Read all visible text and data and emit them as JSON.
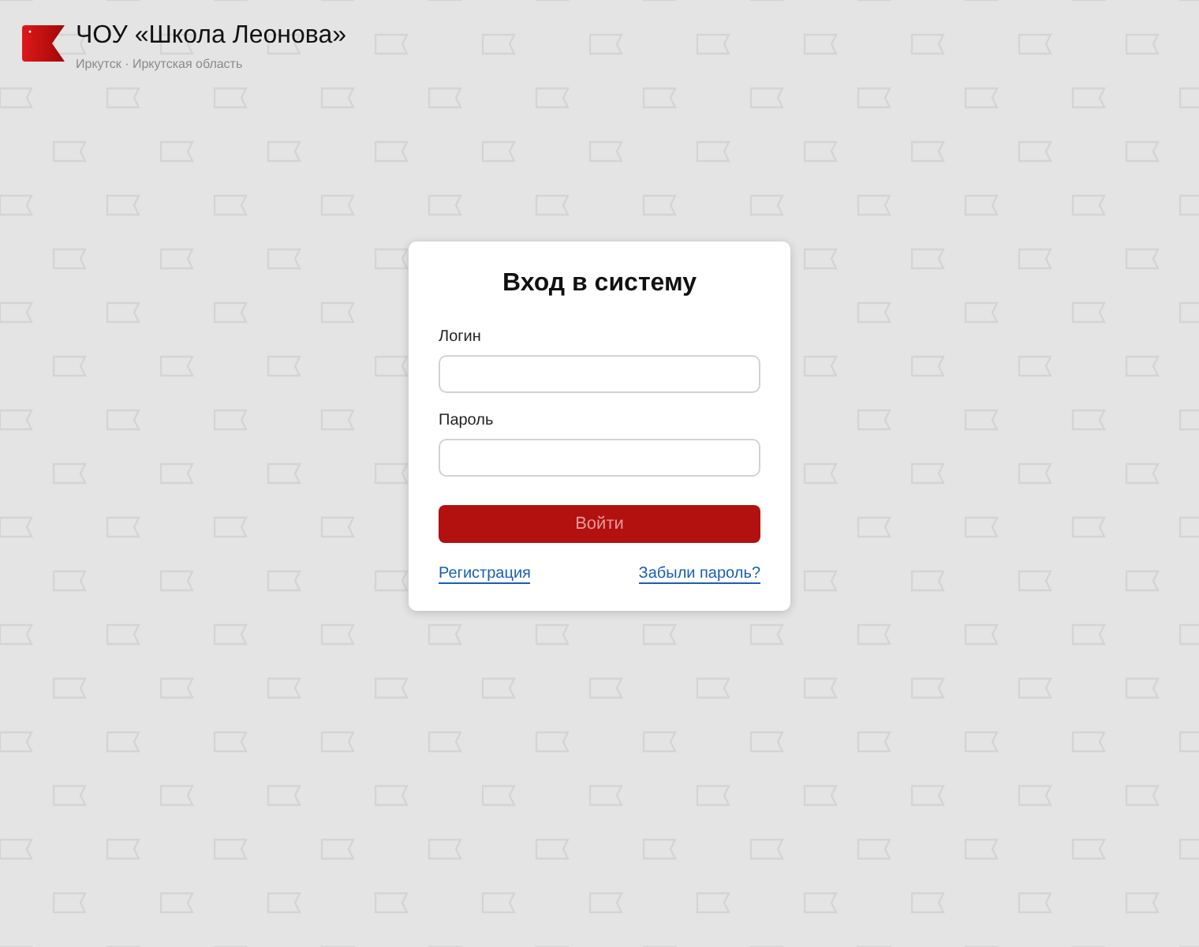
{
  "header": {
    "title": "ЧОУ «Школа Леонова»",
    "subtitle": "Иркутск · Иркутская область"
  },
  "login_form": {
    "title": "Вход в систему",
    "fields": [
      {
        "label": "Логин"
      },
      {
        "label": "Пароль"
      }
    ],
    "submit": {
      "label": "Войти",
      "disabled": true
    },
    "links": [
      "Регистрация",
      "Забыли пароль?"
    ]
  }
}
